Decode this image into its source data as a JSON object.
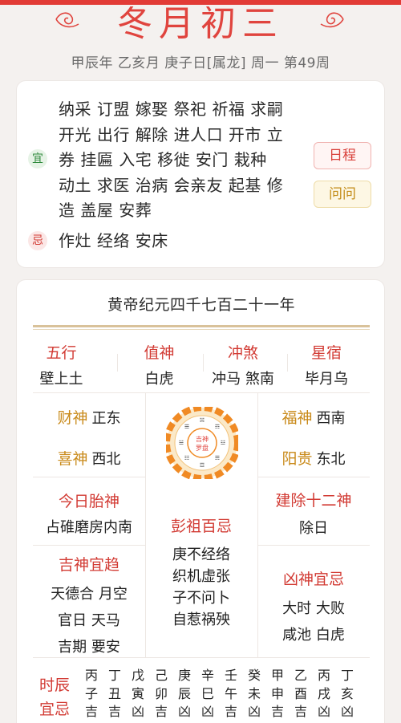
{
  "header": {
    "title": "冬月初三",
    "subtitle": "甲辰年 乙亥月 庚子日[属龙] 周一 第49周"
  },
  "yiji": {
    "yi_tag": "宜",
    "ji_tag": "忌",
    "yi_lines": [
      "纳采 订盟 嫁娶 祭祀 祈福 求嗣",
      "开光 出行 解除 进人口 开市 立",
      "券 挂匾 入宅 移徙 安门 栽种",
      "动土 求医 治病 会亲友 起基 修",
      "造 盖屋 安葬"
    ],
    "ji_lines": [
      "作灶 经络 安床"
    ],
    "buttons": {
      "richeng": "日程",
      "wenwen": "问问"
    }
  },
  "almanac": {
    "era": "黄帝纪元四千七百二十一年",
    "top_row": [
      {
        "label": "五行",
        "value": "壁上土"
      },
      {
        "label": "值神",
        "value": "白虎"
      },
      {
        "label": "冲煞",
        "value": "冲马 煞南"
      },
      {
        "label": "星宿",
        "value": "毕月乌"
      }
    ],
    "caishen": {
      "label": "财神",
      "value": "正东"
    },
    "xishen": {
      "label": "喜神",
      "value": "西北"
    },
    "fushen": {
      "label": "福神",
      "value": "西南"
    },
    "yanggui": {
      "label": "阳贵",
      "value": "东北"
    },
    "taishen": {
      "label": "今日胎神",
      "value": "占碓磨房内南"
    },
    "jianchu": {
      "label": "建除十二神",
      "value": "除日"
    },
    "pengzu": {
      "label": "彭祖百忌",
      "lines": [
        "庚不经络",
        "织机虚张",
        "子不问卜",
        "自惹祸殃"
      ]
    },
    "jishen": {
      "label": "吉神宜趋",
      "lines": [
        "天德合 月空",
        "官日 天马",
        "吉期 要安"
      ]
    },
    "xiongshen": {
      "label": "凶神宜忌",
      "lines": [
        "大时 大败",
        "咸池 白虎"
      ]
    },
    "compass": {
      "center_top": "吉神",
      "center_bottom": "罗盘",
      "trigrams": [
        "坎",
        "艮",
        "震",
        "巽",
        "离",
        "坤",
        "兑",
        "乾"
      ]
    },
    "shichen": {
      "label_top": "时辰",
      "label_bottom": "宜忌",
      "stems": [
        "丙",
        "丁",
        "戊",
        "己",
        "庚",
        "辛",
        "壬",
        "癸",
        "甲",
        "乙",
        "丙",
        "丁"
      ],
      "branches": [
        "子",
        "丑",
        "寅",
        "卯",
        "辰",
        "巳",
        "午",
        "未",
        "申",
        "酉",
        "戌",
        "亥"
      ],
      "luck": [
        "吉",
        "吉",
        "凶",
        "吉",
        "凶",
        "凶",
        "吉",
        "凶",
        "吉",
        "吉",
        "凶",
        "凶"
      ]
    }
  },
  "colors": {
    "accent_red": "#e0443e",
    "green": "#2f8a3c",
    "gold": "#c98a1a"
  }
}
